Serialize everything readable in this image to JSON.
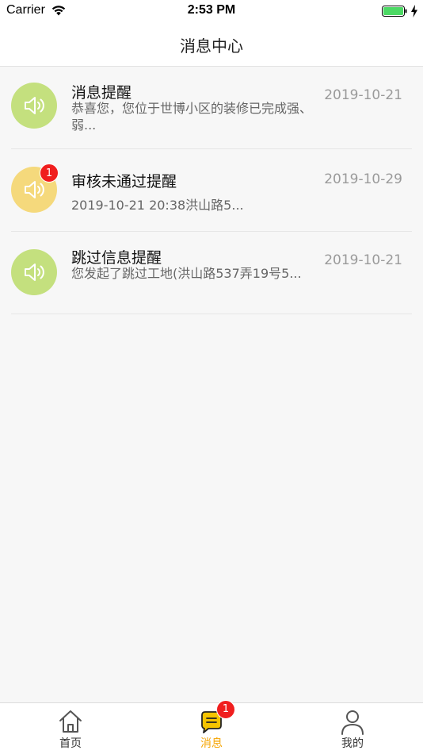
{
  "status_bar": {
    "carrier": "Carrier",
    "time": "2:53 PM"
  },
  "header": {
    "title": "消息中心"
  },
  "messages": [
    {
      "title": "消息提醒",
      "description": "恭喜您，您位于世博小区的装修已完成强、弱...",
      "date": "2019-10-21",
      "icon": "speaker-icon",
      "color": "#c4e07e",
      "badge": ""
    },
    {
      "title": "审核未通过提醒",
      "description": "2019-10-21 20:38洪山路5...",
      "date": "2019-10-29",
      "icon": "speaker-icon",
      "color": "#f5d97c",
      "badge": "1"
    },
    {
      "title": "跳过信息提醒",
      "description": "您发起了跳过工地(洪山路537弄19号5...",
      "date": "2019-10-21",
      "icon": "speaker-icon",
      "color": "#c4e07e",
      "badge": ""
    }
  ],
  "tabs": [
    {
      "label": "首页",
      "icon": "home-icon",
      "active": false
    },
    {
      "label": "消息",
      "icon": "message-icon",
      "active": true,
      "badge": "1"
    },
    {
      "label": "我的",
      "icon": "person-icon",
      "active": false
    }
  ],
  "colors": {
    "accent": "#f5a400",
    "badge": "#f01e1e",
    "battery": "#4cd964"
  }
}
